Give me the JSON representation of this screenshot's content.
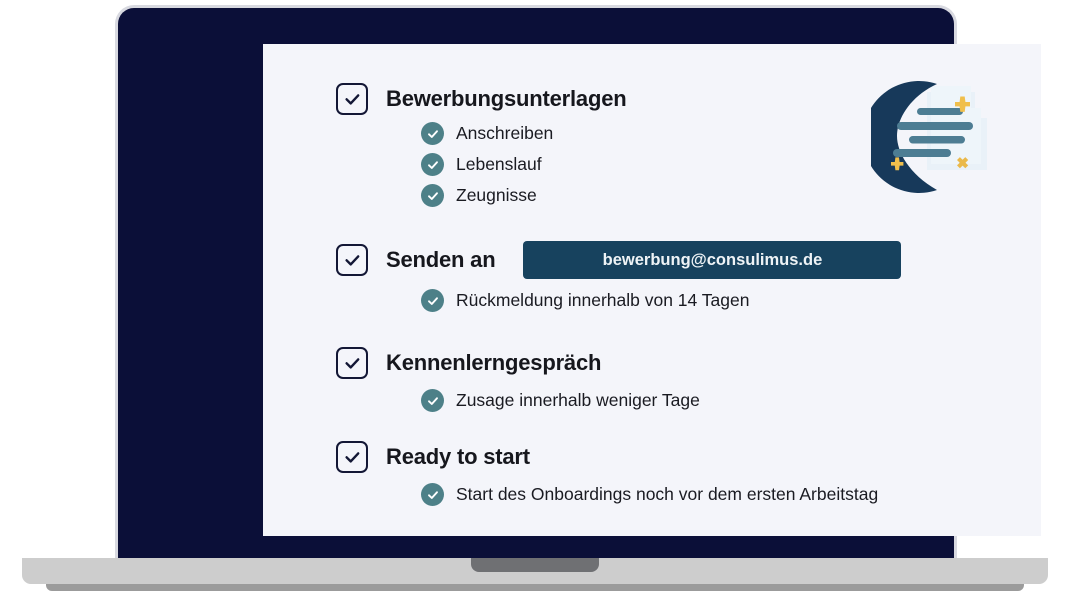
{
  "screen": {
    "background_color": "#f4f5fa",
    "bezel_color": "#0b0f38",
    "base_color": "#cdcdcd"
  },
  "colors": {
    "heading": "#16171d",
    "accent_teal": "#4d8088",
    "chip_background": "#17425e",
    "chip_text": "#eef3f6",
    "checkbox_border": "#131735",
    "illustration_navy": "#17395a",
    "illustration_paper": "#e7f0f7",
    "illustration_gold": "#f2c14a"
  },
  "checklist": {
    "groups": [
      {
        "checkbox_icon": "checkbox-check-icon",
        "title": "Bewerbungsunterlagen",
        "items": [
          {
            "icon": "check-circle-icon",
            "label": "Anschreiben"
          },
          {
            "icon": "check-circle-icon",
            "label": "Lebenslauf"
          },
          {
            "icon": "check-circle-icon",
            "label": "Zeugnisse"
          }
        ]
      },
      {
        "checkbox_icon": "checkbox-check-icon",
        "title": "Senden an",
        "chip": {
          "label": "bewerbung@consulimus.de"
        },
        "items": [
          {
            "icon": "check-circle-icon",
            "label": "Rückmeldung innerhalb von 14 Tagen"
          }
        ]
      },
      {
        "checkbox_icon": "checkbox-check-icon",
        "title": "Kennenlerngespräch",
        "items": [
          {
            "icon": "check-circle-icon",
            "label": "Zusage innerhalb weniger Tage"
          }
        ]
      },
      {
        "checkbox_icon": "checkbox-check-icon",
        "title": "Ready to start",
        "items": [
          {
            "icon": "check-circle-icon",
            "label": "Start des Onboardings noch vor dem ersten Arbeitstag"
          }
        ]
      }
    ]
  },
  "decoration": {
    "illustration_name": "documents-moon-sparkles-illustration"
  },
  "pointer": {
    "icon": "mouse-arrow-cursor"
  }
}
